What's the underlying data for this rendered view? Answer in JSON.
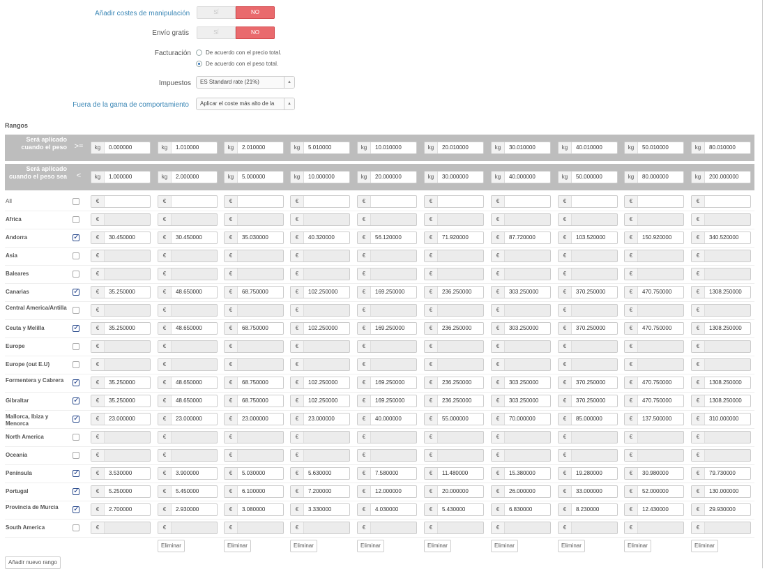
{
  "form": {
    "handling": {
      "label": "Añadir costes de manipulación",
      "yes": "SÍ",
      "no": "NO"
    },
    "free": {
      "label": "Envío gratis",
      "yes": "SÍ",
      "no": "NO"
    },
    "billing": {
      "label": "Facturación",
      "options": [
        "De acuerdo con el precio total.",
        "De acuerdo con el peso total."
      ],
      "selected": 1
    },
    "tax": {
      "label": "Impuestos",
      "value": "ES Standard rate (21%)"
    },
    "outrange": {
      "label": "Fuera de la gama de comportamiento",
      "value": "Aplicar el coste más alto de la"
    }
  },
  "ranges": {
    "title": "Rangos",
    "from_label": "Será aplicado cuando el peso",
    "from_op": ">=",
    "to_label": "Será aplicado cuando el peso sea",
    "to_op": "<",
    "unit": "kg",
    "currency": "€",
    "from": [
      "0.000000",
      "1.010000",
      "2.010000",
      "5.010000",
      "10.010000",
      "20.010000",
      "30.010000",
      "40.010000",
      "50.010000",
      "80.010000"
    ],
    "to": [
      "1.000000",
      "2.000000",
      "5.000000",
      "10.000000",
      "20.000000",
      "30.000000",
      "40.000000",
      "50.000000",
      "80.000000",
      "200.000000"
    ],
    "zones": [
      {
        "name": "All",
        "checked": false,
        "all": true,
        "values": []
      },
      {
        "name": "Africa",
        "checked": false,
        "values": []
      },
      {
        "name": "Andorra",
        "checked": true,
        "values": [
          "30.450000",
          "30.450000",
          "35.030000",
          "40.320000",
          "56.120000",
          "71.920000",
          "87.720000",
          "103.520000",
          "150.920000",
          "340.520000"
        ]
      },
      {
        "name": "Asia",
        "checked": false,
        "values": []
      },
      {
        "name": "Baleares",
        "checked": false,
        "values": []
      },
      {
        "name": "Canarias",
        "checked": true,
        "values": [
          "35.250000",
          "48.650000",
          "68.750000",
          "102.250000",
          "169.250000",
          "236.250000",
          "303.250000",
          "370.250000",
          "470.750000",
          "1308.250000"
        ]
      },
      {
        "name": "Central America/Antilla",
        "checked": false,
        "values": []
      },
      {
        "name": "Ceuta y Melilla",
        "checked": true,
        "values": [
          "35.250000",
          "48.650000",
          "68.750000",
          "102.250000",
          "169.250000",
          "236.250000",
          "303.250000",
          "370.250000",
          "470.750000",
          "1308.250000"
        ]
      },
      {
        "name": "Europe",
        "checked": false,
        "values": []
      },
      {
        "name": "Europe (out E.U)",
        "checked": false,
        "values": []
      },
      {
        "name": "Formentera y Cabrera",
        "checked": true,
        "values": [
          "35.250000",
          "48.650000",
          "68.750000",
          "102.250000",
          "169.250000",
          "236.250000",
          "303.250000",
          "370.250000",
          "470.750000",
          "1308.250000"
        ]
      },
      {
        "name": "Gibraltar",
        "checked": true,
        "values": [
          "35.250000",
          "48.650000",
          "68.750000",
          "102.250000",
          "169.250000",
          "236.250000",
          "303.250000",
          "370.250000",
          "470.750000",
          "1308.250000"
        ]
      },
      {
        "name": "Mallorca, Ibiza y Menorca",
        "checked": true,
        "values": [
          "23.000000",
          "23.000000",
          "23.000000",
          "23.000000",
          "40.000000",
          "55.000000",
          "70.000000",
          "85.000000",
          "137.500000",
          "310.000000"
        ]
      },
      {
        "name": "North America",
        "checked": false,
        "values": []
      },
      {
        "name": "Oceania",
        "checked": false,
        "values": []
      },
      {
        "name": "Península",
        "checked": true,
        "values": [
          "3.530000",
          "3.900000",
          "5.030000",
          "5.630000",
          "7.580000",
          "11.480000",
          "15.380000",
          "19.280000",
          "30.980000",
          "79.730000"
        ]
      },
      {
        "name": "Portugal",
        "checked": true,
        "values": [
          "5.250000",
          "5.450000",
          "6.100000",
          "7.200000",
          "12.000000",
          "20.000000",
          "26.000000",
          "33.000000",
          "52.000000",
          "130.000000"
        ]
      },
      {
        "name": "Provincia de Murcia",
        "checked": true,
        "values": [
          "2.700000",
          "2.930000",
          "3.080000",
          "3.330000",
          "4.030000",
          "5.430000",
          "6.830000",
          "8.230000",
          "12.430000",
          "29.930000"
        ]
      },
      {
        "name": "South America",
        "checked": false,
        "values": []
      }
    ],
    "delete_label": "Eliminar",
    "add_label": "Añadir nuevo rango"
  }
}
